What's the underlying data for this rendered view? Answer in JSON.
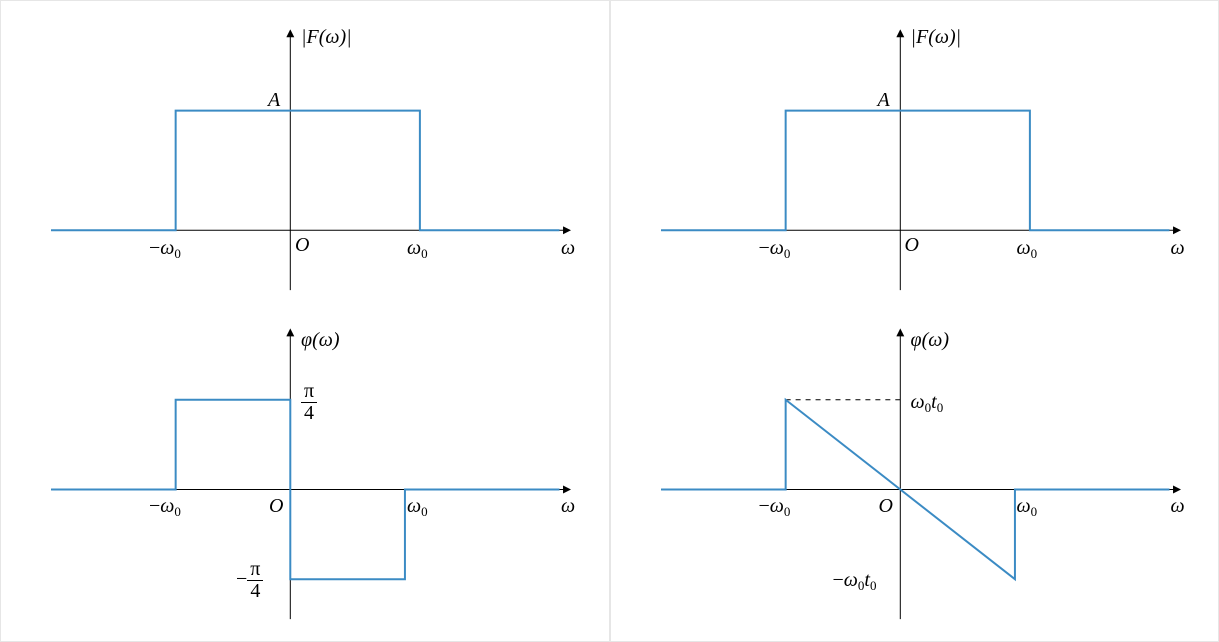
{
  "colors": {
    "curve": "#3b8bc4"
  },
  "left": {
    "mag": {
      "ylabel": "|F(ω)|",
      "A": "A",
      "neg_w0": "−ω",
      "pos_w0": "ω",
      "sub0": "0",
      "origin": "O",
      "xlabel": "ω"
    },
    "phase": {
      "ylabel": "φ(ω)",
      "pos_level": "π/4",
      "neg_level": "−π/4",
      "neg_w0": "−ω",
      "pos_w0": "ω",
      "sub0": "0",
      "origin": "O",
      "xlabel": "ω"
    }
  },
  "right": {
    "mag": {
      "ylabel": "|F(ω)|",
      "A": "A",
      "neg_w0": "−ω",
      "pos_w0": "ω",
      "sub0": "0",
      "origin": "O",
      "xlabel": "ω"
    },
    "phase": {
      "ylabel": "φ(ω)",
      "pos_level": "ω₀t₀",
      "neg_level": "−ω₀t₀",
      "neg_w0": "−ω",
      "pos_w0": "ω",
      "sub0": "0",
      "origin": "O",
      "xlabel": "ω"
    }
  },
  "chart_data": [
    {
      "type": "line",
      "title": "|F(ω)| (left)",
      "xlabel": "ω",
      "ylabel": "|F(ω)|",
      "series": [
        {
          "name": "|F(ω)|",
          "x": [
            "-∞",
            "-ω₀",
            "-ω₀",
            "ω₀",
            "ω₀",
            "∞"
          ],
          "y": [
            0,
            0,
            "A",
            "A",
            0,
            0
          ]
        }
      ],
      "xticks": [
        "-ω₀",
        "0",
        "ω₀"
      ],
      "yticks": [
        "A"
      ]
    },
    {
      "type": "line",
      "title": "φ(ω) (left)",
      "xlabel": "ω",
      "ylabel": "φ(ω)",
      "series": [
        {
          "name": "φ(ω)",
          "x": [
            "-∞",
            "-ω₀",
            "-ω₀",
            "0",
            "0",
            "ω₀",
            "ω₀",
            "∞"
          ],
          "y": [
            0,
            0,
            "π/4",
            "π/4",
            "-π/4",
            "-π/4",
            0,
            0
          ]
        }
      ],
      "xticks": [
        "-ω₀",
        "0",
        "ω₀"
      ],
      "yticks": [
        "π/4",
        "-π/4"
      ]
    },
    {
      "type": "line",
      "title": "|F(ω)| (right)",
      "xlabel": "ω",
      "ylabel": "|F(ω)|",
      "series": [
        {
          "name": "|F(ω)|",
          "x": [
            "-∞",
            "-ω₀",
            "-ω₀",
            "ω₀",
            "ω₀",
            "∞"
          ],
          "y": [
            0,
            0,
            "A",
            "A",
            0,
            0
          ]
        }
      ],
      "xticks": [
        "-ω₀",
        "0",
        "ω₀"
      ],
      "yticks": [
        "A"
      ]
    },
    {
      "type": "line",
      "title": "φ(ω) (right)",
      "xlabel": "ω",
      "ylabel": "φ(ω)",
      "series": [
        {
          "name": "φ(ω)",
          "x": [
            "-∞",
            "-ω₀",
            "-ω₀",
            "0",
            "ω₀",
            "ω₀",
            "∞"
          ],
          "y": [
            0,
            0,
            "ω₀t₀",
            0,
            "-ω₀t₀",
            0,
            0
          ]
        }
      ],
      "xticks": [
        "-ω₀",
        "0",
        "ω₀"
      ],
      "yticks": [
        "ω₀t₀",
        "-ω₀t₀"
      ]
    }
  ]
}
